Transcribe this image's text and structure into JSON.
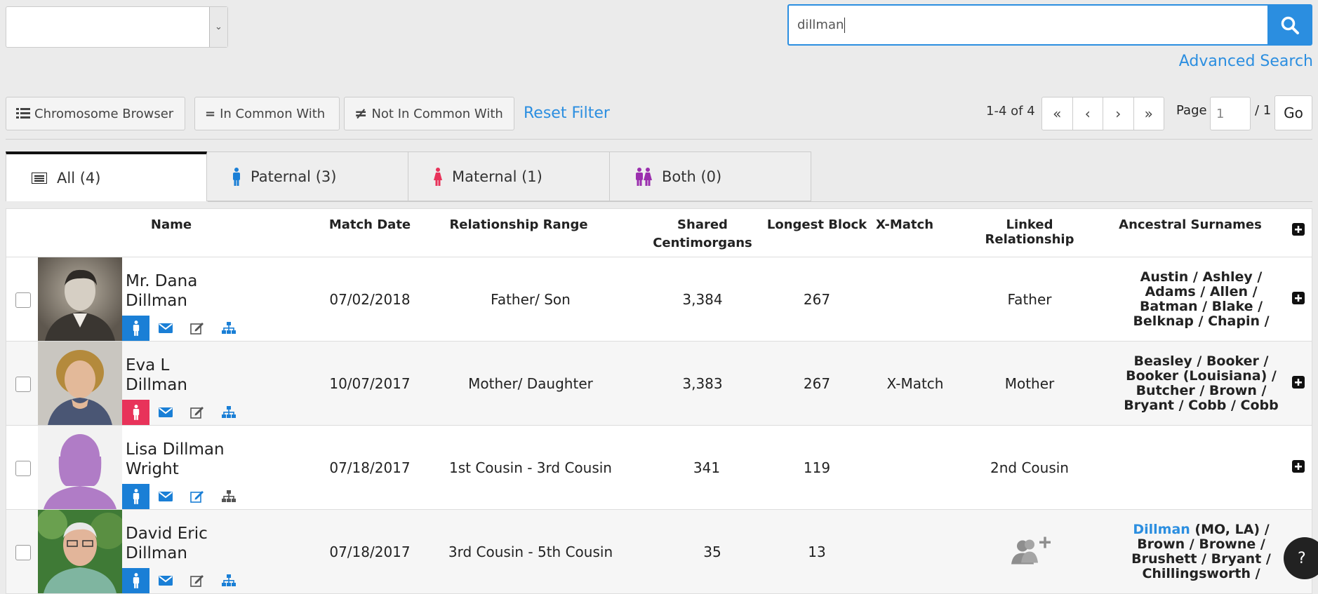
{
  "search": {
    "value": "dillman",
    "advanced_label": "Advanced Search"
  },
  "toolbar": {
    "chromosome_label": "Chromosome Browser",
    "in_common_label": "In Common With",
    "not_in_common_label": "Not In Common With",
    "reset_label": "Reset Filter"
  },
  "pagination": {
    "range": "1-4 of 4",
    "first": "«",
    "prev": "‹",
    "next": "›",
    "last": "»",
    "page_label": "Page",
    "page_value": "1",
    "total": "/ 1",
    "go_label": "Go"
  },
  "tabs": [
    {
      "label": "All (4)"
    },
    {
      "label": "Paternal (3)"
    },
    {
      "label": "Maternal (1)"
    },
    {
      "label": "Both (0)"
    }
  ],
  "columns": {
    "name": "Name",
    "match_date": "Match Date",
    "relationship_range": "Relationship Range",
    "shared_cm_1": "Shared",
    "shared_cm_2": "Centimorgans",
    "longest_block": "Longest Block",
    "x_match": "X-Match",
    "linked_relationship": "Linked Relationship",
    "ancestral_surnames": "Ancestral Surnames"
  },
  "rows": [
    {
      "name_1": "Mr. Dana",
      "name_2": "Dillman",
      "match_date": "07/02/2018",
      "relationship_range": "Father/ Son",
      "shared_cm": "3,384",
      "longest_block": "267",
      "x_match": "",
      "linked_relationship": "Father",
      "surnames": "Austin / Ashley / Adams / Allen / Batman / Blake / Belknap / Chapin /",
      "side": "paternal"
    },
    {
      "name_1": "Eva L",
      "name_2": "Dillman",
      "match_date": "10/07/2017",
      "relationship_range": "Mother/ Daughter",
      "shared_cm": "3,383",
      "longest_block": "267",
      "x_match": "X-Match",
      "linked_relationship": "Mother",
      "surnames": "Beasley / Booker / Booker (Louisiana) / Butcher / Brown / Bryant / Cobb / Cobb",
      "side": "maternal"
    },
    {
      "name_1": "Lisa Dillman",
      "name_2": "Wright",
      "match_date": "07/18/2017",
      "relationship_range": "1st Cousin - 3rd Cousin",
      "shared_cm": "341",
      "longest_block": "119",
      "x_match": "",
      "linked_relationship": "2nd Cousin",
      "surnames": "",
      "side": "paternal"
    },
    {
      "name_1": "David Eric",
      "name_2": "Dillman",
      "match_date": "07/18/2017",
      "relationship_range": "3rd Cousin - 5th Cousin",
      "shared_cm": "35",
      "longest_block": "13",
      "x_match": "",
      "linked_relationship": "",
      "surnames_highlight": "Dillman",
      "surnames": " (MO, LA) / Brown / Browne / Brushett / Bryant / Chillingsworth /",
      "side": "paternal"
    }
  ],
  "colors": {
    "accent": "#2b8ee0",
    "paternal": "#1a7fd6",
    "maternal": "#e8335a",
    "both": "#9b2fae",
    "silhouette": "#b07cc6"
  }
}
